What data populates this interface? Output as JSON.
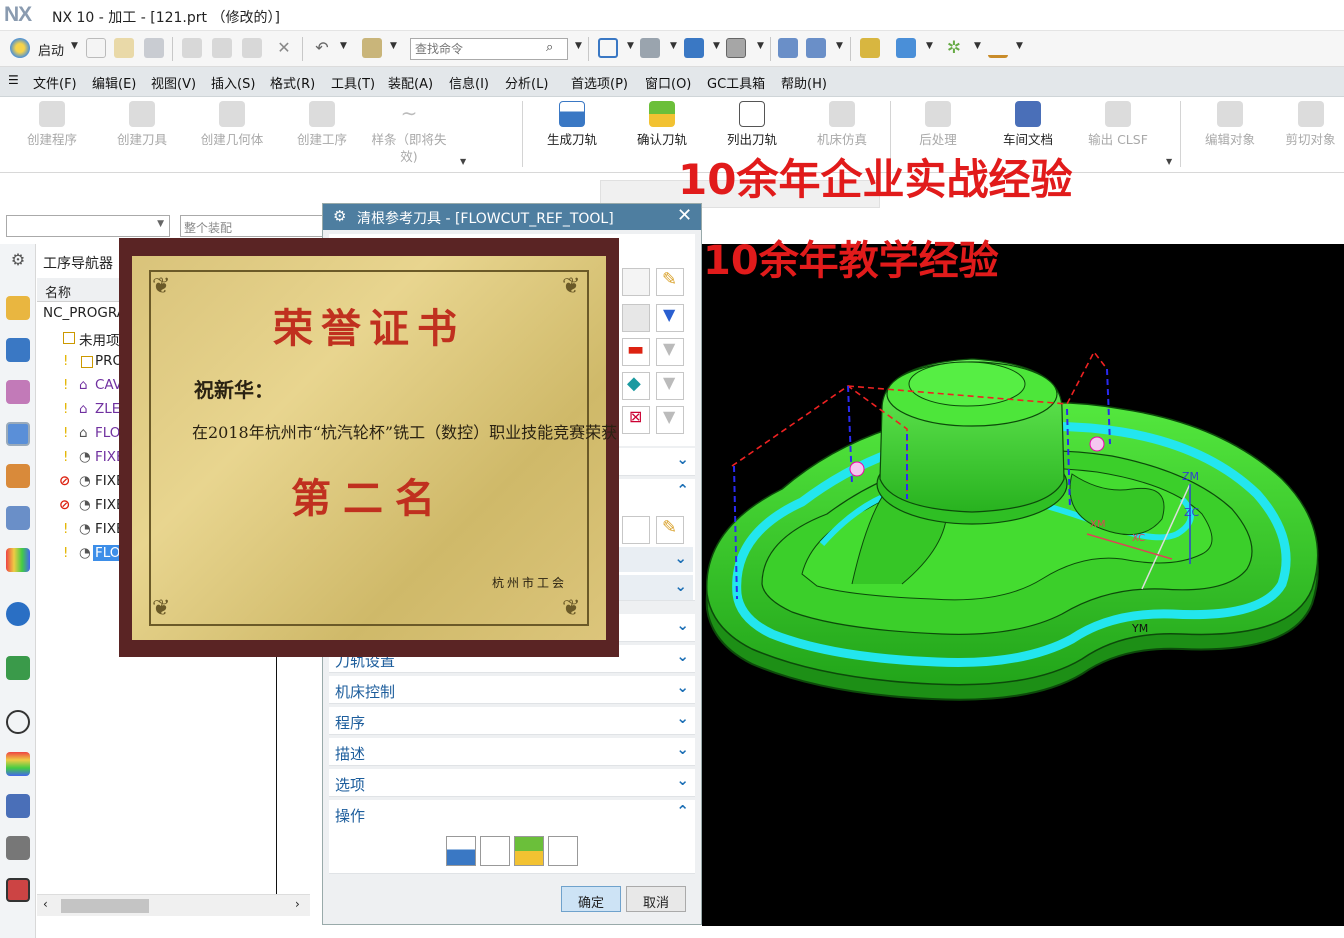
{
  "window": {
    "logo": "NX",
    "title": "NX 10 - 加工 - [121.prt （修改的）]"
  },
  "quickbar": {
    "start_label": "启动",
    "search_placeholder": "查找命令"
  },
  "menu": [
    "文件(F)",
    "编辑(E)",
    "视图(V)",
    "插入(S)",
    "格式(R)",
    "工具(T)",
    "装配(A)",
    "信息(I)",
    "分析(L)",
    "首选项(P)",
    "窗口(O)",
    "GC工具箱",
    "帮助(H)"
  ],
  "ribbon": {
    "create_program": "创建程序",
    "create_tool": "创建刀具",
    "create_geometry": "创建几何体",
    "create_operation": "创建工序",
    "spline": "样条（即将失效)",
    "generate_path": "生成刀轨",
    "verify_path": "确认刀轨",
    "list_path": "列出刀轨",
    "machine_sim": "机床仿真",
    "post_process": "后处理",
    "shop_doc": "车间文档",
    "output_clsf": "输出 CLSF",
    "edit_object": "编辑对象",
    "cut_object": "剪切对象"
  },
  "filter": {
    "scope_placeholder": "整个装配"
  },
  "navigator": {
    "title": "工序导航器",
    "column_name": "名称",
    "rows": [
      "NC_PROGRAM",
      "未用项",
      "PRO",
      "CAV",
      "ZLE",
      "FLO",
      "FIXE",
      "FIXE",
      "FIXE",
      "FIXE",
      "FLO"
    ]
  },
  "dialog": {
    "title": "清根参考刀具 - [FLOWCUT_REF_TOOL]",
    "sections": {
      "toolpath_settings": "刀轨设置",
      "machine_control": "机床控制",
      "program": "程序",
      "description": "描述",
      "options": "选项",
      "actions": "操作"
    },
    "ok_label": "确定",
    "cancel_label": "取消"
  },
  "certificate": {
    "title": "荣誉证书",
    "recipient": "祝新华：",
    "body": "在2018年杭州市“杭汽轮杯”铣工（数控）职业技能竞赛荣获",
    "rank": "第二名",
    "issuer": "杭州市工会"
  },
  "overlay": {
    "line1": "10余年企业实战经验",
    "line2": "10余年教学经验"
  },
  "viewport": {
    "axis_zm": "ZM",
    "axis_ym": "YM",
    "axis_zc": "ZC",
    "axis_xc": "XC",
    "axis_xm": "XM"
  },
  "colors": {
    "accent_blue": "#4e7ea0",
    "section_text": "#1c5d9c",
    "part_green": "#3ed12e",
    "toolpath_cyan": "#23e6ee",
    "ad_red": "#e11b1b"
  }
}
